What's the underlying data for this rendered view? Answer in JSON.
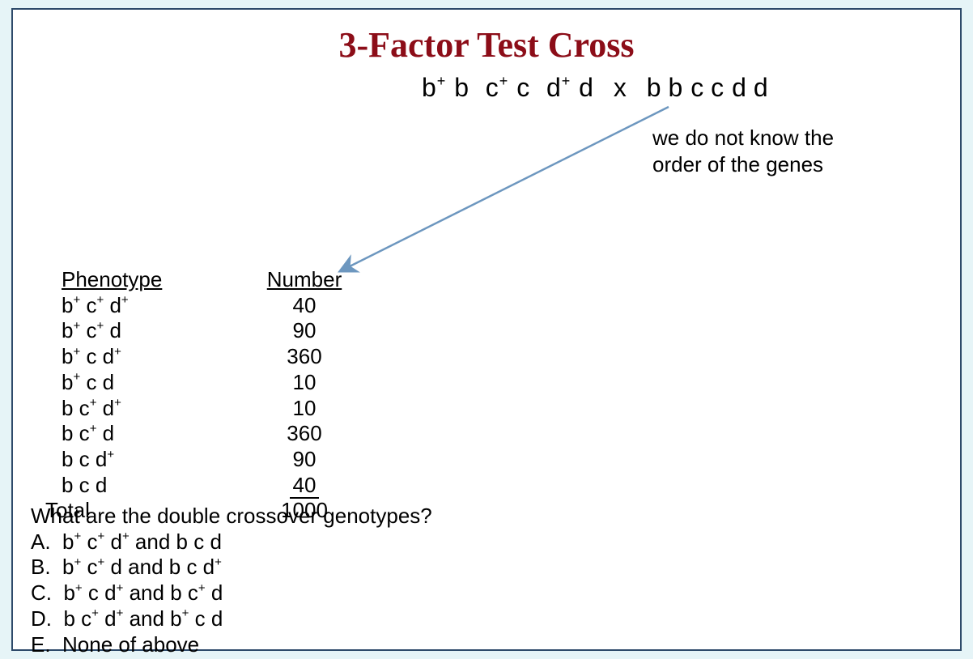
{
  "title": "3-Factor Test Cross",
  "cross": {
    "het": {
      "b": "b",
      "bplus": "+",
      "c": "c",
      "cplus": "+",
      "d": "d",
      "dplus": "+"
    },
    "x": "x",
    "hom": {
      "bb": "b b",
      "cc": "c c",
      "dd": "d d"
    }
  },
  "note_line1": "we do not know the",
  "note_line2": "order of the genes",
  "table": {
    "hdr_pheno": "Phenotype",
    "hdr_num": "Number",
    "rows": [
      {
        "pheno_html": "b<sup>+</sup> c<sup>+</sup> d<sup>+</sup>",
        "num": "40"
      },
      {
        "pheno_html": "b<sup>+</sup> c<sup>+</sup> d",
        "num": "90"
      },
      {
        "pheno_html": "b<sup>+</sup> c d<sup>+</sup>",
        "num": "360"
      },
      {
        "pheno_html": "b<sup>+</sup> c d",
        "num": "10"
      },
      {
        "pheno_html": "b c<sup>+</sup> d<sup>+</sup>",
        "num": "10"
      },
      {
        "pheno_html": "b c<sup>+</sup> d",
        "num": "360"
      },
      {
        "pheno_html": "b c d<sup>+</sup>",
        "num": "90"
      },
      {
        "pheno_html": "b c d",
        "num": "40"
      }
    ],
    "total_label": "Total",
    "total_value": "1000"
  },
  "question": {
    "prompt": "What are the double crossover genotypes?",
    "options": [
      {
        "key": "A.",
        "html": "b<sup>+</sup> c<sup>+</sup> d<sup>+</sup> and b c d"
      },
      {
        "key": "B.",
        "html": "b<sup>+</sup> c<sup>+</sup> d and b c d<sup>+</sup>"
      },
      {
        "key": "C.",
        "html": "b<sup>+</sup> c d<sup>+</sup> and b c<sup>+</sup> d"
      },
      {
        "key": "D.",
        "html": "b c<sup>+</sup> d<sup>+</sup> and b<sup>+</sup> c d"
      },
      {
        "key": "E.",
        "html": "None of above"
      }
    ]
  }
}
